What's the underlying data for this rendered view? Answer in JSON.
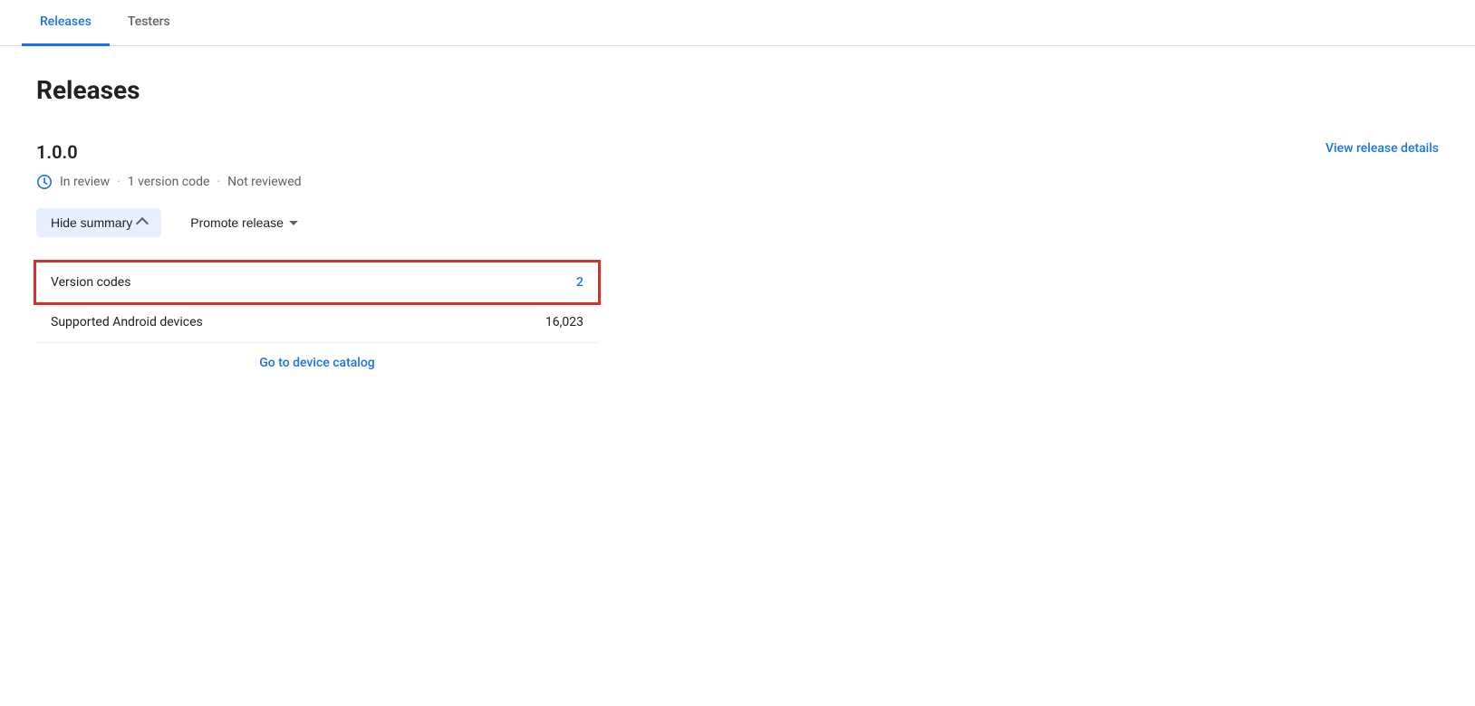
{
  "tabs": [
    {
      "id": "releases",
      "label": "Releases",
      "active": true
    },
    {
      "id": "testers",
      "label": "Testers",
      "active": false
    }
  ],
  "page": {
    "title": "Releases"
  },
  "release": {
    "version": "1.0.0",
    "status": "In review",
    "version_code_count": "1 version code",
    "review_status": "Not reviewed",
    "view_details_label": "View release details",
    "dot": "·"
  },
  "buttons": {
    "hide_summary": "Hide summary",
    "promote_release": "Promote release"
  },
  "summary": {
    "version_codes_label": "Version codes",
    "version_codes_value": "2",
    "supported_devices_label": "Supported Android devices",
    "supported_devices_value": "16,023",
    "device_catalog_label": "Go to device catalog"
  },
  "colors": {
    "blue": "#1a73e8",
    "red": "#d93025",
    "tab_active": "#1a73e8"
  }
}
